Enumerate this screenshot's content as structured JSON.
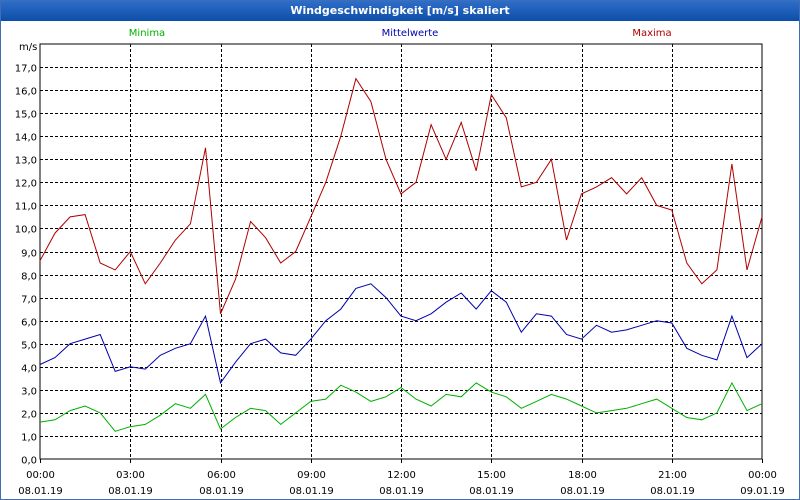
{
  "window": {
    "title": "Windgeschwindigkeit [m/s] skaliert"
  },
  "chart_data": {
    "type": "line",
    "title": "Windgeschwindigkeit [m/s] skaliert",
    "ylabel": "m/s",
    "xlabel": "",
    "ylim": [
      0,
      18
    ],
    "xlim": [
      0,
      24
    ],
    "grid": true,
    "legend_position": "top",
    "y_ticks": [
      "0,0",
      "1,0",
      "2,0",
      "3,0",
      "4,0",
      "5,0",
      "6,0",
      "7,0",
      "8,0",
      "9,0",
      "10,0",
      "11,0",
      "12,0",
      "13,0",
      "14,0",
      "15,0",
      "16,0",
      "17,0"
    ],
    "x_ticks": [
      {
        "time": "00:00",
        "date": "08.01.19"
      },
      {
        "time": "03:00",
        "date": "08.01.19"
      },
      {
        "time": "06:00",
        "date": "08.01.19"
      },
      {
        "time": "09:00",
        "date": "08.01.19"
      },
      {
        "time": "12:00",
        "date": "08.01.19"
      },
      {
        "time": "15:00",
        "date": "08.01.19"
      },
      {
        "time": "18:00",
        "date": "08.01.19"
      },
      {
        "time": "21:00",
        "date": "08.01.19"
      },
      {
        "time": "00:00",
        "date": "09.01.19"
      }
    ],
    "x_hours": [
      0,
      0.5,
      1,
      1.5,
      2,
      2.5,
      3,
      3.5,
      4,
      4.5,
      5,
      5.5,
      6,
      6.5,
      7,
      7.5,
      8,
      8.5,
      9,
      9.5,
      10,
      10.5,
      11,
      11.5,
      12,
      12.5,
      13,
      13.5,
      14,
      14.5,
      15,
      15.5,
      16,
      16.5,
      17,
      17.5,
      18,
      18.5,
      19,
      19.5,
      20,
      20.5,
      21,
      21.5,
      22,
      22.5,
      23,
      23.5,
      24
    ],
    "series": [
      {
        "name": "Minima",
        "color": "#00b000",
        "values": [
          1.6,
          1.7,
          2.1,
          2.3,
          2.0,
          1.2,
          1.4,
          1.5,
          1.9,
          2.4,
          2.2,
          2.8,
          1.3,
          1.8,
          2.2,
          2.1,
          1.5,
          2.0,
          2.5,
          2.6,
          3.2,
          2.9,
          2.5,
          2.7,
          3.1,
          2.6,
          2.3,
          2.8,
          2.7,
          3.3,
          2.9,
          2.7,
          2.2,
          2.5,
          2.8,
          2.6,
          2.3,
          2.0,
          2.1,
          2.2,
          2.4,
          2.6,
          2.2,
          1.8,
          1.7,
          2.0,
          3.3,
          2.1,
          2.4
        ]
      },
      {
        "name": "Mittelwerte",
        "color": "#0000b0",
        "values": [
          4.1,
          4.4,
          5.0,
          5.2,
          5.4,
          3.8,
          4.0,
          3.9,
          4.5,
          4.8,
          5.0,
          6.2,
          3.3,
          4.2,
          5.0,
          5.2,
          4.6,
          4.5,
          5.2,
          6.0,
          6.5,
          7.4,
          7.6,
          7.0,
          6.2,
          6.0,
          6.3,
          6.8,
          7.2,
          6.5,
          7.3,
          6.8,
          5.5,
          6.3,
          6.2,
          5.4,
          5.2,
          5.8,
          5.5,
          5.6,
          5.8,
          6.0,
          5.9,
          4.8,
          4.5,
          4.3,
          6.2,
          4.4,
          5.0
        ]
      },
      {
        "name": "Maxima",
        "color": "#b00000",
        "values": [
          8.6,
          9.8,
          10.5,
          10.6,
          8.5,
          8.2,
          9.0,
          7.6,
          8.5,
          9.5,
          10.2,
          13.5,
          6.3,
          7.8,
          10.3,
          9.6,
          8.5,
          9.0,
          10.5,
          12.0,
          14.0,
          16.5,
          15.5,
          13.0,
          11.5,
          12.0,
          14.5,
          13.0,
          14.6,
          12.5,
          15.8,
          14.8,
          11.8,
          12.0,
          13.0,
          9.5,
          11.5,
          11.8,
          12.2,
          11.5,
          12.2,
          11.0,
          10.8,
          8.5,
          7.6,
          8.2,
          12.8,
          8.2,
          10.5
        ]
      }
    ]
  }
}
